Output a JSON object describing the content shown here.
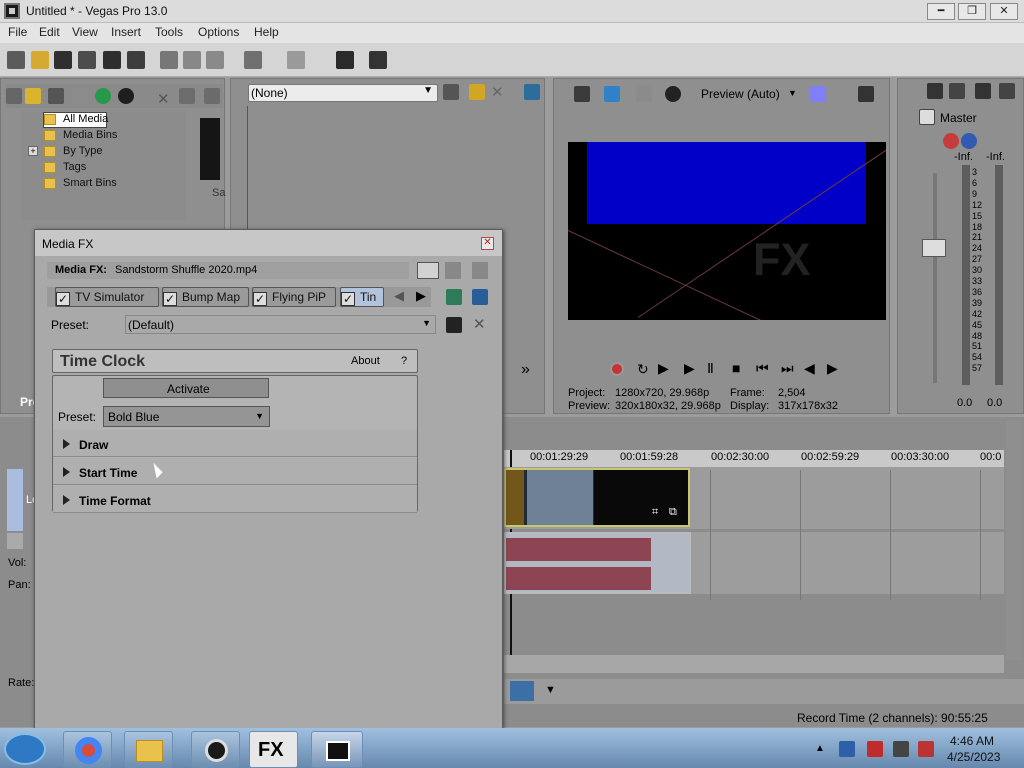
{
  "window": {
    "title": "Untitled * - Vegas Pro 13.0"
  },
  "menubar": {
    "items": [
      "File",
      "Edit",
      "View",
      "Insert",
      "Tools",
      "Options",
      "Help"
    ]
  },
  "media": {
    "tree": [
      "All Media",
      "Media Bins",
      "By Type",
      "Tags",
      "Smart Bins"
    ]
  },
  "trimmer": {
    "selection": "(None)"
  },
  "preview": {
    "mode": "Preview (Auto)",
    "project_label": "Project:",
    "project_value": "1280x720, 29.968p",
    "frame_label": "Frame:",
    "frame_value": "2,504",
    "preview_label": "Preview:",
    "preview_value": "320x180x32, 29.968p",
    "display_label": "Display:",
    "display_value": "317x178x32",
    "watermark": "FX"
  },
  "mixer": {
    "name": "Master",
    "left_peak": "-Inf.",
    "right_peak": "-Inf.",
    "scale": [
      "3",
      "6",
      "9",
      "12",
      "15",
      "18",
      "21",
      "24",
      "27",
      "30",
      "33",
      "36",
      "39",
      "42",
      "45",
      "48",
      "51",
      "54",
      "57"
    ],
    "left_value": "0.0",
    "right_value": "0.0"
  },
  "dialog": {
    "title": "Media FX",
    "source_label": "Media FX:",
    "source_value": "Sandstorm Shuffle 2020.mp4",
    "tabs": [
      "TV Simulator",
      "Bump Map",
      "Flying PiP",
      "Tin"
    ],
    "preset_label": "Preset:",
    "preset_value": "(Default)",
    "plugin_title": "Time Clock",
    "about": "About",
    "help": "?",
    "activate": "Activate",
    "inner_preset_label": "Preset:",
    "inner_preset_value": "Bold Blue",
    "sections": [
      "Draw",
      "Start Time",
      "Time Format"
    ]
  },
  "timeline": {
    "times": [
      "00:01:29:29",
      "00:01:59:28",
      "00:02:30:00",
      "00:02:59:29",
      "00:03:30:00",
      "00:0"
    ],
    "left_labels": [
      "Vol:",
      "Pan:",
      "Rate:"
    ],
    "record_time": "Record Time (2 channels): 90:55:25"
  },
  "taskbar": {
    "time": "4:46 AM",
    "date": "4/25/2023"
  },
  "misc": {
    "pro": "Pro",
    "le": "Le",
    "sa": "Sa"
  },
  "colors": {
    "blue": "#0000c8",
    "audio": "#8e4553"
  }
}
